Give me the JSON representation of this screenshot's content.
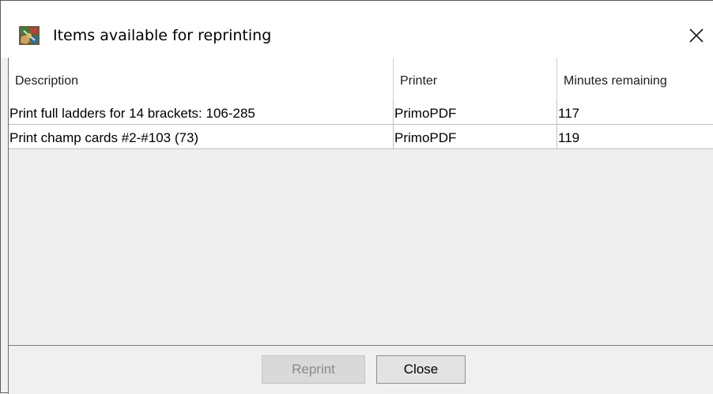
{
  "window": {
    "title": "Items available for reprinting",
    "app_icon": "tournament-app-icon",
    "close_icon": "close-icon"
  },
  "table": {
    "columns": [
      "Description",
      "Printer",
      "Minutes remaining"
    ],
    "rows": [
      {
        "description": "Print full ladders for 14 brackets: 106-285",
        "printer": "PrimoPDF",
        "minutes": "117"
      },
      {
        "description": "Print champ cards #2-#103 (73)",
        "printer": "PrimoPDF",
        "minutes": "119"
      }
    ]
  },
  "buttons": {
    "reprint_label": "Reprint",
    "reprint_enabled": false,
    "close_label": "Close"
  },
  "colors": {
    "title_bar": "#ffffff",
    "panel": "#f0f0f0",
    "disabled_text": "#8a8a8a"
  }
}
